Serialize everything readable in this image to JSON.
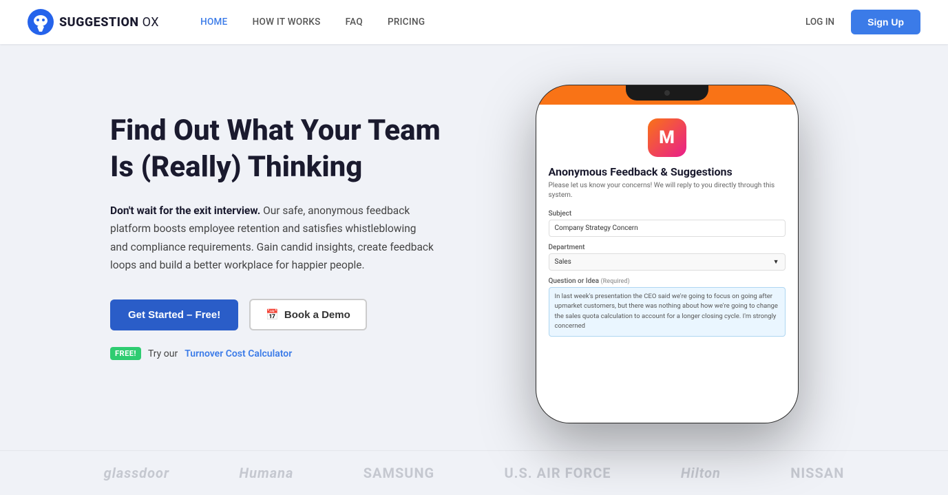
{
  "navbar": {
    "logo_text": "SUGGESTION",
    "logo_suffix": "OX",
    "links": [
      {
        "label": "HOME",
        "id": "home",
        "active": true
      },
      {
        "label": "HOW IT WORKS",
        "id": "how-it-works"
      },
      {
        "label": "FAQ",
        "id": "faq"
      },
      {
        "label": "PRICING",
        "id": "pricing"
      },
      {
        "label": "LOG IN",
        "id": "login"
      }
    ],
    "signup_label": "Sign Up"
  },
  "hero": {
    "title": "Find Out What Your Team Is (Really) Thinking",
    "desc_bold": "Don't wait for the exit interview.",
    "desc_rest": " Our safe, anonymous feedback platform boosts employee retention and satisfies whistleblowing and compliance requirements. Gain candid insights, create feedback loops and build a better workplace for happier people.",
    "btn_started": "Get Started – Free!",
    "btn_demo_icon": "📅",
    "btn_demo": "Book a Demo",
    "badge_free": "FREE!",
    "badge_text": "Try our",
    "badge_link": "Turnover Cost Calculator"
  },
  "phone": {
    "app_letter": "M",
    "form_title": "Anonymous Feedback & Suggestions",
    "form_subtitle": "Please let us know your concerns! We will reply to you directly through this system.",
    "subject_label": "Subject",
    "subject_value": "Company Strategy Concern",
    "department_label": "Department",
    "department_value": "Sales",
    "question_label": "Question or Idea",
    "question_required": "(Required)",
    "question_value": "In last week's presentation the CEO said we're going to focus on going after upmarket customers, but there was nothing about how we're going to change the sales quota calculation to account for a longer closing cycle. I'm strongly concerned"
  },
  "brands": [
    {
      "name": "glassdoor",
      "style": "italic"
    },
    {
      "name": "Humana",
      "style": "italic"
    },
    {
      "name": "SAMSUNG",
      "style": "sans"
    },
    {
      "name": "U.S. AIR FORCE",
      "style": "sans"
    },
    {
      "name": "Hilton",
      "style": "italic"
    },
    {
      "name": "NISSAN",
      "style": "sans"
    }
  ]
}
